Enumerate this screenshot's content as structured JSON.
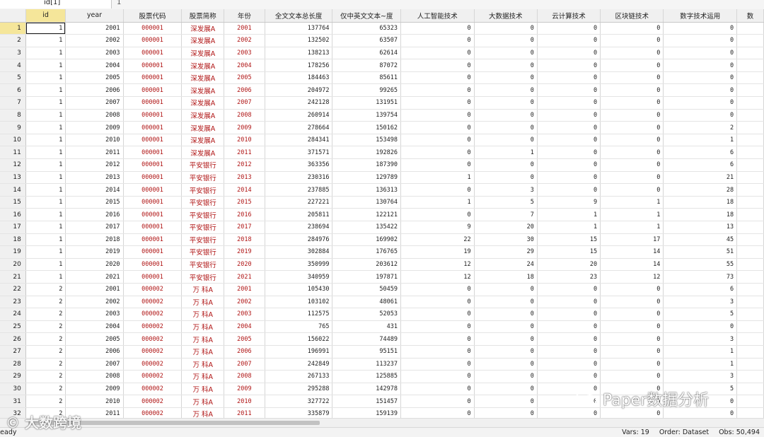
{
  "cellbar": {
    "ref": "id[1]",
    "value": "1"
  },
  "columns": [
    "",
    "id",
    "year",
    "股票代码",
    "股票简称",
    "年份",
    "全文文本总长度",
    "仅中英文文本~度",
    "人工智能技术",
    "大数据技术",
    "云计算技术",
    "区块链技术",
    "数字技术运用",
    "数"
  ],
  "rows": [
    [
      "1",
      "1",
      "2001",
      "000001",
      "深发展A",
      "2001",
      "137764",
      "65323",
      "0",
      "0",
      "0",
      "0",
      "0"
    ],
    [
      "2",
      "1",
      "2002",
      "000001",
      "深发展A",
      "2002",
      "132502",
      "63507",
      "0",
      "0",
      "0",
      "0",
      "0"
    ],
    [
      "3",
      "1",
      "2003",
      "000001",
      "深发展A",
      "2003",
      "138213",
      "62614",
      "0",
      "0",
      "0",
      "0",
      "0"
    ],
    [
      "4",
      "1",
      "2004",
      "000001",
      "深发展A",
      "2004",
      "178256",
      "87072",
      "0",
      "0",
      "0",
      "0",
      "0"
    ],
    [
      "5",
      "1",
      "2005",
      "000001",
      "深发展A",
      "2005",
      "184463",
      "85611",
      "0",
      "0",
      "0",
      "0",
      "0"
    ],
    [
      "6",
      "1",
      "2006",
      "000001",
      "深发展A",
      "2006",
      "204972",
      "99265",
      "0",
      "0",
      "0",
      "0",
      "0"
    ],
    [
      "7",
      "1",
      "2007",
      "000001",
      "深发展A",
      "2007",
      "242128",
      "131951",
      "0",
      "0",
      "0",
      "0",
      "0"
    ],
    [
      "8",
      "1",
      "2008",
      "000001",
      "深发展A",
      "2008",
      "260914",
      "139754",
      "0",
      "0",
      "0",
      "0",
      "0"
    ],
    [
      "9",
      "1",
      "2009",
      "000001",
      "深发展A",
      "2009",
      "278664",
      "150162",
      "0",
      "0",
      "0",
      "0",
      "2"
    ],
    [
      "10",
      "1",
      "2010",
      "000001",
      "深发展A",
      "2010",
      "284341",
      "153498",
      "0",
      "0",
      "0",
      "0",
      "1"
    ],
    [
      "11",
      "1",
      "2011",
      "000001",
      "深发展A",
      "2011",
      "371571",
      "192826",
      "0",
      "1",
      "0",
      "0",
      "6"
    ],
    [
      "12",
      "1",
      "2012",
      "000001",
      "平安银行",
      "2012",
      "363356",
      "187390",
      "0",
      "0",
      "0",
      "0",
      "6"
    ],
    [
      "13",
      "1",
      "2013",
      "000001",
      "平安银行",
      "2013",
      "230316",
      "129789",
      "1",
      "0",
      "0",
      "0",
      "21"
    ],
    [
      "14",
      "1",
      "2014",
      "000001",
      "平安银行",
      "2014",
      "237885",
      "136313",
      "0",
      "3",
      "0",
      "0",
      "28"
    ],
    [
      "15",
      "1",
      "2015",
      "000001",
      "平安银行",
      "2015",
      "227221",
      "130764",
      "1",
      "5",
      "9",
      "1",
      "18"
    ],
    [
      "16",
      "1",
      "2016",
      "000001",
      "平安银行",
      "2016",
      "205811",
      "122121",
      "0",
      "7",
      "1",
      "1",
      "18"
    ],
    [
      "17",
      "1",
      "2017",
      "000001",
      "平安银行",
      "2017",
      "238694",
      "135422",
      "9",
      "20",
      "1",
      "1",
      "13"
    ],
    [
      "18",
      "1",
      "2018",
      "000001",
      "平安银行",
      "2018",
      "284976",
      "169902",
      "22",
      "30",
      "15",
      "17",
      "45"
    ],
    [
      "19",
      "1",
      "2019",
      "000001",
      "平安银行",
      "2019",
      "302884",
      "176765",
      "19",
      "29",
      "15",
      "14",
      "51"
    ],
    [
      "20",
      "1",
      "2020",
      "000001",
      "平安银行",
      "2020",
      "350999",
      "203612",
      "12",
      "24",
      "20",
      "14",
      "55"
    ],
    [
      "21",
      "1",
      "2021",
      "000001",
      "平安银行",
      "2021",
      "340959",
      "197871",
      "12",
      "18",
      "23",
      "12",
      "73"
    ],
    [
      "22",
      "2",
      "2001",
      "000002",
      "万  科A",
      "2001",
      "105430",
      "50459",
      "0",
      "0",
      "0",
      "0",
      "6"
    ],
    [
      "23",
      "2",
      "2002",
      "000002",
      "万  科A",
      "2002",
      "103102",
      "48061",
      "0",
      "0",
      "0",
      "0",
      "3"
    ],
    [
      "24",
      "2",
      "2003",
      "000002",
      "万  科A",
      "2003",
      "112575",
      "52053",
      "0",
      "0",
      "0",
      "0",
      "5"
    ],
    [
      "25",
      "2",
      "2004",
      "000002",
      "万  科A",
      "2004",
      "765",
      "431",
      "0",
      "0",
      "0",
      "0",
      "0"
    ],
    [
      "26",
      "2",
      "2005",
      "000002",
      "万  科A",
      "2005",
      "156022",
      "74489",
      "0",
      "0",
      "0",
      "0",
      "3"
    ],
    [
      "27",
      "2",
      "2006",
      "000002",
      "万  科A",
      "2006",
      "196991",
      "95151",
      "0",
      "0",
      "0",
      "0",
      "1"
    ],
    [
      "28",
      "2",
      "2007",
      "000002",
      "万  科A",
      "2007",
      "242849",
      "113237",
      "0",
      "0",
      "0",
      "0",
      "1"
    ],
    [
      "29",
      "2",
      "2008",
      "000002",
      "万  科A",
      "2008",
      "267133",
      "125885",
      "0",
      "0",
      "0",
      "0",
      "3"
    ],
    [
      "30",
      "2",
      "2009",
      "000002",
      "万  科A",
      "2009",
      "295288",
      "142978",
      "0",
      "0",
      "0",
      "0",
      "5"
    ],
    [
      "31",
      "2",
      "2010",
      "000002",
      "万  科A",
      "2010",
      "327722",
      "151457",
      "0",
      "0",
      "0",
      "0",
      "0"
    ],
    [
      "32",
      "2",
      "2011",
      "000002",
      "万  科A",
      "2011",
      "335879",
      "159139",
      "0",
      "0",
      "0",
      "0",
      "0"
    ]
  ],
  "status": {
    "left": "Ready",
    "vars": "Vars: 19",
    "order": "Order: Dataset",
    "obs": "Obs: 50,494"
  },
  "watermarks": {
    "bottom_left": "大数跨境",
    "wechat": "Paper数据分析"
  },
  "colors": {
    "accent_selected": "#f5e69a",
    "code_text": "#b01515"
  }
}
